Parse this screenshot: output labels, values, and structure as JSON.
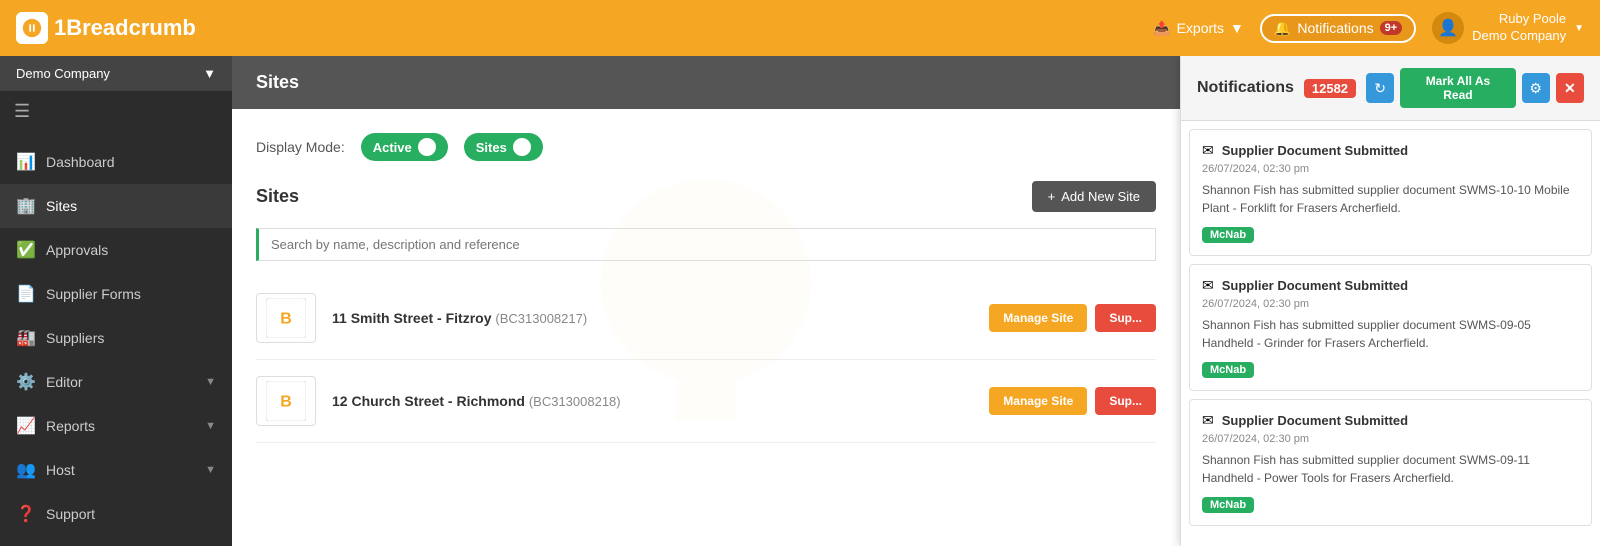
{
  "topNav": {
    "logo": {
      "icon": "B",
      "text1": "1Bread",
      "text2": "crumb"
    },
    "exports": {
      "label": "Exports"
    },
    "notifications": {
      "label": "Notifications",
      "badge": "9+",
      "panelCount": "12582"
    },
    "user": {
      "name": "Ruby Poole",
      "company": "Demo Company",
      "avatar": "👤"
    }
  },
  "sidebar": {
    "companyBtn": "Demo Company",
    "items": [
      {
        "id": "dashboard",
        "label": "Dashboard",
        "icon": "📊",
        "arrow": false
      },
      {
        "id": "sites",
        "label": "Sites",
        "icon": "🏢",
        "arrow": false,
        "active": true
      },
      {
        "id": "approvals",
        "label": "Approvals",
        "icon": "✅",
        "arrow": false
      },
      {
        "id": "supplier-forms",
        "label": "Supplier Forms",
        "icon": "📄",
        "arrow": false
      },
      {
        "id": "suppliers",
        "label": "Suppliers",
        "icon": "🏭",
        "arrow": false
      },
      {
        "id": "editor",
        "label": "Editor",
        "icon": "⚙️",
        "arrow": true
      },
      {
        "id": "reports",
        "label": "Reports",
        "icon": "📈",
        "arrow": true
      },
      {
        "id": "host",
        "label": "Host",
        "icon": "👥",
        "arrow": true
      },
      {
        "id": "support",
        "label": "Support",
        "icon": "❓",
        "arrow": false
      }
    ]
  },
  "content": {
    "pageTitle": "Sites",
    "displayMode": {
      "label": "Display Mode:",
      "activeToggle": "Active",
      "sitesToggle": "Sites"
    },
    "sitesSection": {
      "title": "Sites",
      "addNewBtn": "+ Add New Site",
      "searchPlaceholder": "Search by name, description and reference"
    },
    "sites": [
      {
        "name": "11 Smith Street - Fitzroy",
        "code": "BC313008217",
        "manageBtn": "Manage Site",
        "supBtn": "Sup..."
      },
      {
        "name": "12 Church Street - Richmond",
        "code": "BC313008218",
        "manageBtn": "Manage Site",
        "supBtn": "Sup..."
      }
    ]
  },
  "notificationPanel": {
    "title": "Notifications",
    "count": "12582",
    "markAllRead": "Mark All As Read",
    "notifications": [
      {
        "title": "Supplier Document Submitted",
        "time": "26/07/2024, 02:30 pm",
        "body": "Shannon Fish has submitted supplier document SWMS-10-10 Mobile Plant - Forklift for Frasers Archerfield.",
        "tag": "McNab"
      },
      {
        "title": "Supplier Document Submitted",
        "time": "26/07/2024, 02:30 pm",
        "body": "Shannon Fish has submitted supplier document SWMS-09-05 Handheld - Grinder for Frasers Archerfield.",
        "tag": "McNab"
      },
      {
        "title": "Supplier Document Submitted",
        "time": "26/07/2024, 02:30 pm",
        "body": "Shannon Fish has submitted supplier document SWMS-09-11 Handheld - Power Tools for Frasers Archerfield.",
        "tag": "McNab"
      }
    ]
  }
}
